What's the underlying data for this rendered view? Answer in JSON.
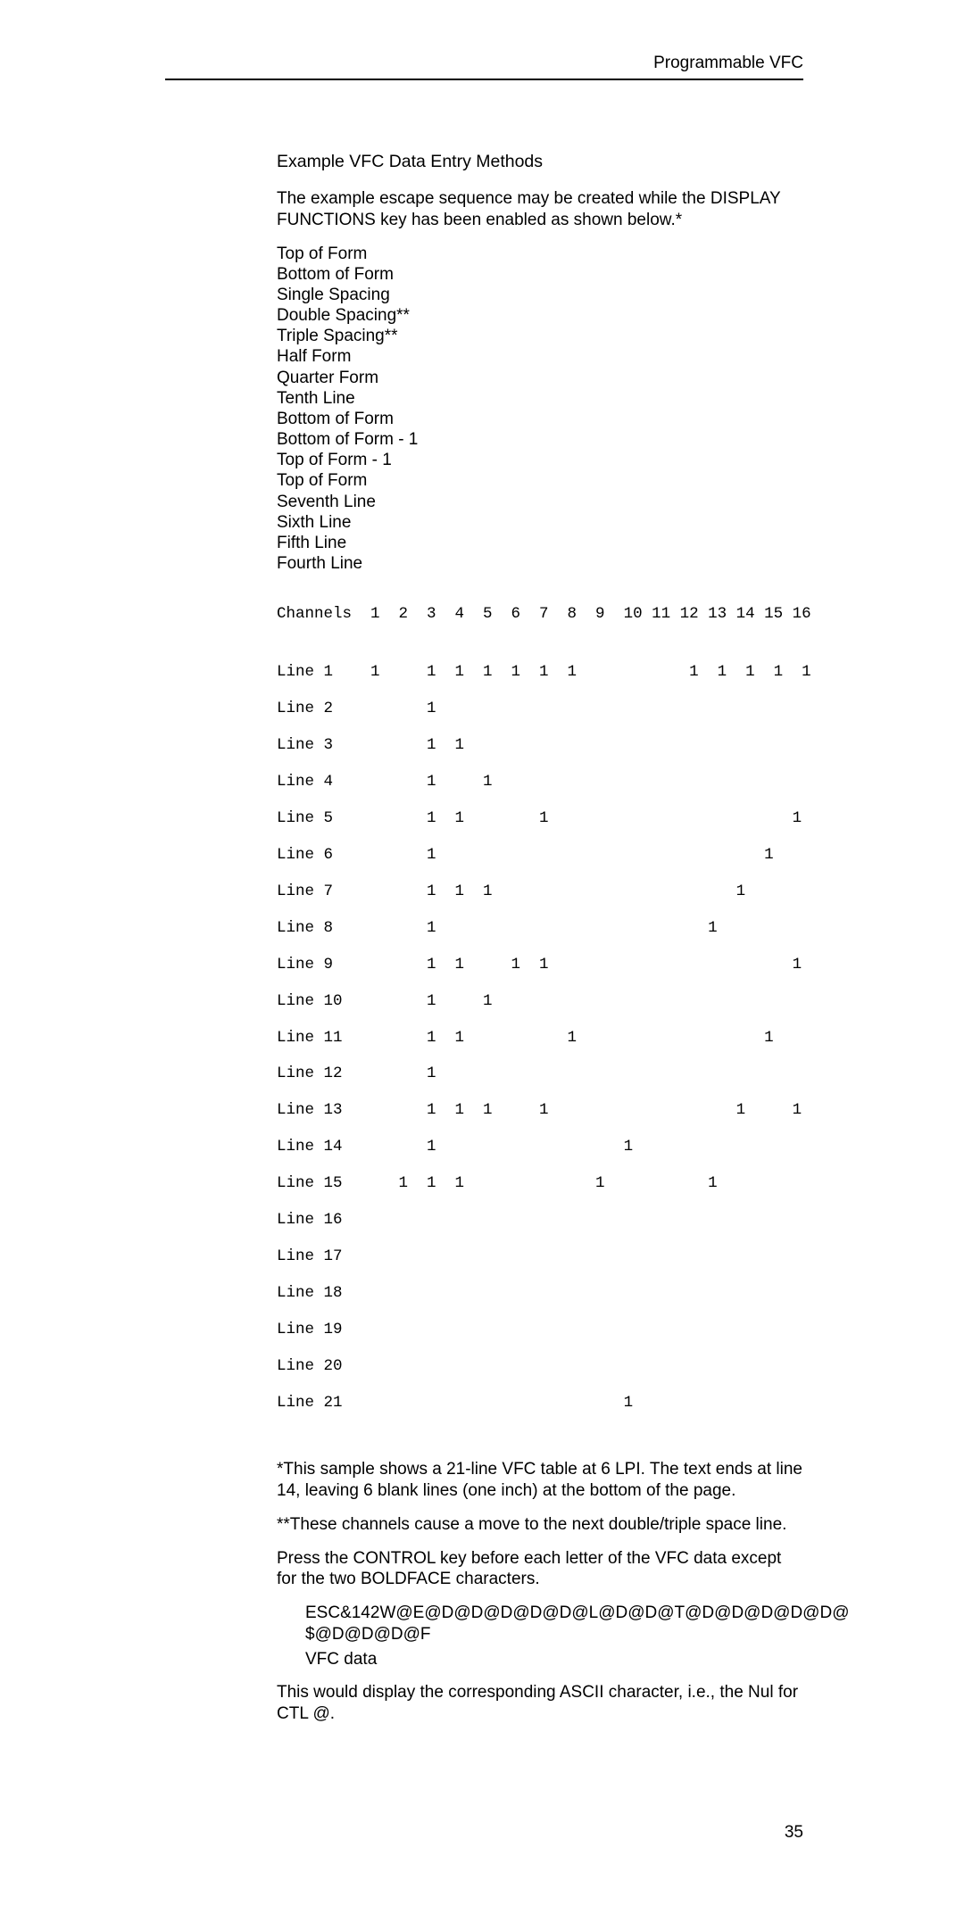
{
  "running_head": "Programmable VFC",
  "section_title": "Example VFC Data Entry Methods",
  "intro": "The example escape sequence may be created while the DISPLAY FUNCTIONS key has been enabled as shown below.*",
  "defs": {
    "l1": "Top of Form",
    "l2": "Bottom of Form",
    "l3": "Single Spacing",
    "l4": "Double Spacing**",
    "l5": "Triple Spacing**",
    "l6": "Half Form",
    "l7": "Quarter Form",
    "l8": "Tenth Line",
    "l9": "Bottom of Form",
    "l10": "Bottom of Form - 1",
    "l11": "Top of Form - 1",
    "l12": "Top of Form",
    "l13": "Seventh Line",
    "l14": "Sixth Line",
    "l15": "Fifth Line",
    "l16": "Fourth Line"
  },
  "table": {
    "header": "Channels  1  2  3  4  5  6  7  8  9  10 11 12 13 14 15 16",
    "rows": [
      "Line 1    1     1  1  1  1  1  1            1  1  1  1  1",
      "Line 2          1",
      "Line 3          1  1",
      "Line 4          1     1",
      "Line 5          1  1        1                          1",
      "Line 6          1                                   1",
      "Line 7          1  1  1                          1",
      "Line 8          1                             1",
      "Line 9          1  1     1  1                          1",
      "Line 10         1     1",
      "Line 11         1  1           1                    1",
      "Line 12         1",
      "Line 13         1  1  1     1                    1     1",
      "Line 14         1                    1",
      "Line 15      1  1  1              1           1",
      "Line 16",
      "Line 17",
      "Line 18",
      "Line 19",
      "Line 20",
      "Line 21                              1"
    ]
  },
  "note1": "*This sample shows a 21-line VFC table at 6 LPI. The text ends at line 14, leaving 6 blank lines (one inch) at the bottom of the page.",
  "note2": "**These channels cause a move to the next double/triple space line.",
  "note3": "Press the CONTROL key before each letter of the VFC data except for the two BOLDFACE characters.",
  "esc1": "ESC&142W@E@D@D@D@D@D@L@D@D@T@D@D@D@D@D@",
  "esc2": "$@D@D@D@F",
  "vfc_label": "VFC data",
  "closing": "This would display the corresponding ASCII character, i.e., the Nul for CTL @.",
  "page_number": "35"
}
